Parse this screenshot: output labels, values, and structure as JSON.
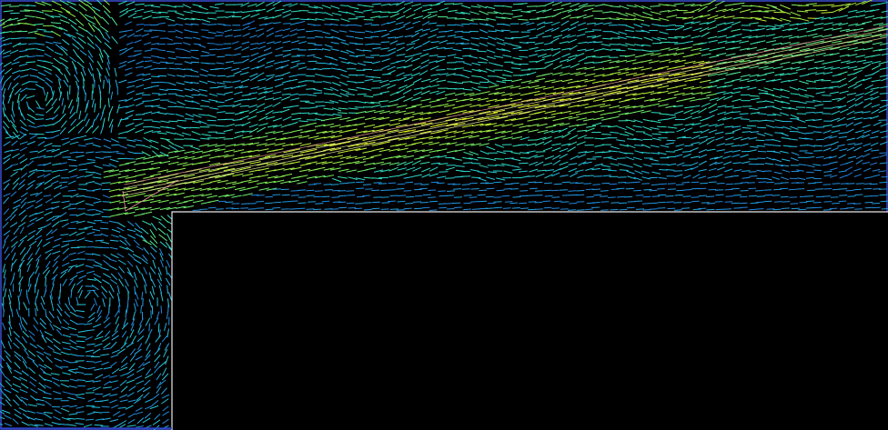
{
  "visualization": {
    "kind": "cfd-velocity-vector-field",
    "colormap": [
      "#1a2ea8",
      "#1f6fd6",
      "#22b6e6",
      "#2fe0c0",
      "#7ef05a",
      "#e8f020"
    ],
    "background_color": "#000000",
    "frame_color": "#3a4fd0",
    "wall_color": "#e8e8e8",
    "jet_edge_colors": [
      "#f0a0a0",
      "#f0f0a0"
    ],
    "features": {
      "solid_block": "present",
      "inclined_jet": "present",
      "recirculation_left": "present"
    }
  }
}
